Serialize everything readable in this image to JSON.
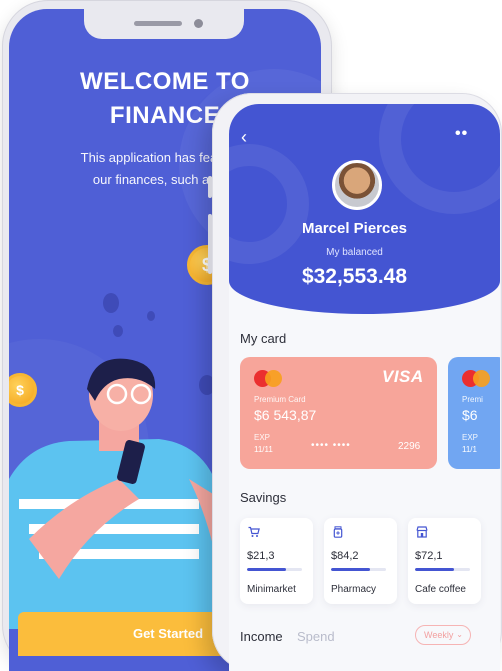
{
  "onboarding": {
    "title_line1": "WELCOME TO",
    "title_line2": "FINANCE",
    "description_line1": "This application has features t",
    "description_line2": "our finances, such as trac",
    "get_started_label": "Get Started",
    "coin_symbol": "$",
    "background_color": "#4f5fd6",
    "button_color": "#fbbd3c"
  },
  "profile": {
    "name": "Marcel Pierces",
    "balance_label": "My balanced",
    "balance": "$32,553.48",
    "header_color": "#4455d2"
  },
  "my_card": {
    "section_title": "My card",
    "cards": [
      {
        "brand": "VISA",
        "label": "Premium Card",
        "amount": "$6 543,87",
        "exp_label": "EXP",
        "exp_value": "11/11",
        "masked": "•••• ••••",
        "last4": "2296",
        "color": "#f7a59a"
      },
      {
        "label": "Premi",
        "amount": "$6",
        "exp_label": "EXP",
        "exp_value": "11/1",
        "color": "#71a6f2"
      }
    ]
  },
  "savings": {
    "section_title": "Savings",
    "items": [
      {
        "icon": "cart-icon",
        "value": "$21,3",
        "name": "Minimarket",
        "progress": 0.7
      },
      {
        "icon": "pill-bottle-icon",
        "value": "$84,2",
        "name": "Pharmacy",
        "progress": 0.7
      },
      {
        "icon": "store-icon",
        "value": "$72,1",
        "name": "Cafe coffee",
        "progress": 0.7
      }
    ]
  },
  "tabs": {
    "income": "Income",
    "spend": "Spend",
    "period": "Weekly"
  }
}
